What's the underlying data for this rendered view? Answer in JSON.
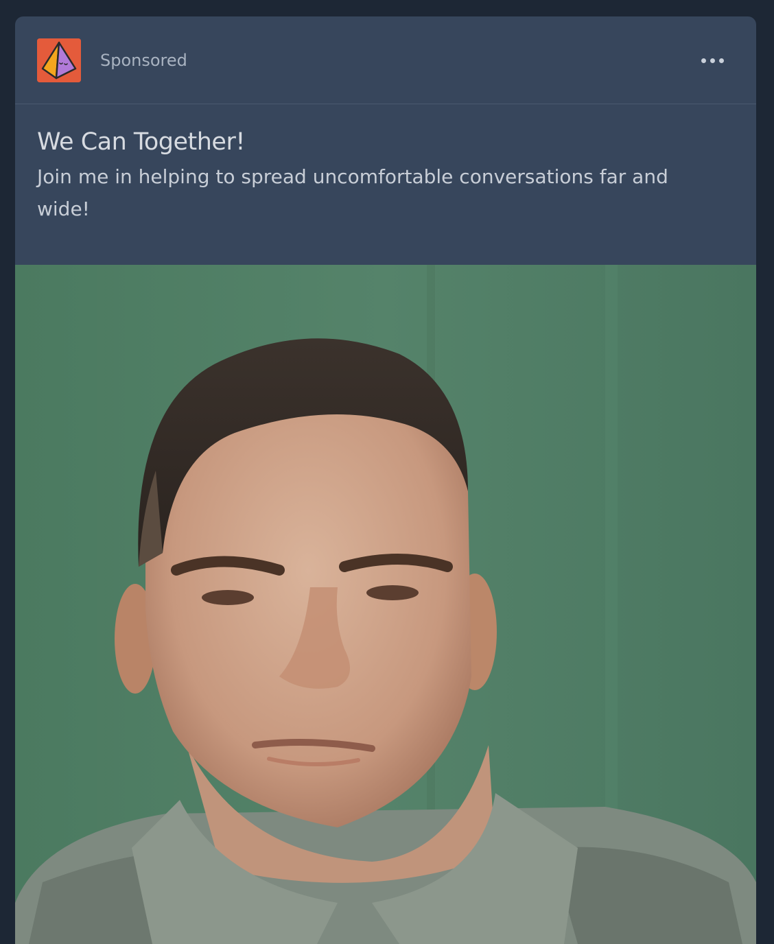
{
  "post": {
    "sponsored_label": "Sponsored",
    "headline": "We Can Together!",
    "description": "Join me in helping to spread uncomfortable conversations far and wide!",
    "avatar_icon": "pyramid-logo-icon",
    "menu_icon": "more-options-icon"
  },
  "colors": {
    "page_background": "#1d2735",
    "card_background": "#37465c",
    "avatar_background": "#e45b3b",
    "photo_background": "#4f7a62"
  }
}
